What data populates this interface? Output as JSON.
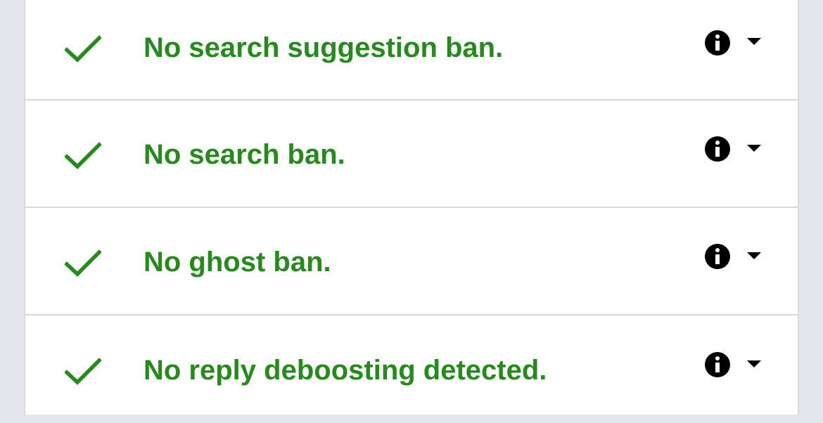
{
  "results": [
    {
      "status": "pass",
      "text": "No search suggestion ban.",
      "info_icon": "info-icon",
      "toggle_icon": "caret-down-icon"
    },
    {
      "status": "pass",
      "text": "No search ban.",
      "info_icon": "info-icon",
      "toggle_icon": "caret-down-icon"
    },
    {
      "status": "pass",
      "text": "No ghost ban.",
      "info_icon": "info-icon",
      "toggle_icon": "caret-down-icon"
    },
    {
      "status": "pass",
      "text": "No reply deboosting detected.",
      "info_icon": "info-icon",
      "toggle_icon": "caret-down-icon"
    }
  ],
  "colors": {
    "pass": "#268a1d",
    "icon": "#000000",
    "divider": "#d9d9d9",
    "background": "#e4e6eb"
  }
}
